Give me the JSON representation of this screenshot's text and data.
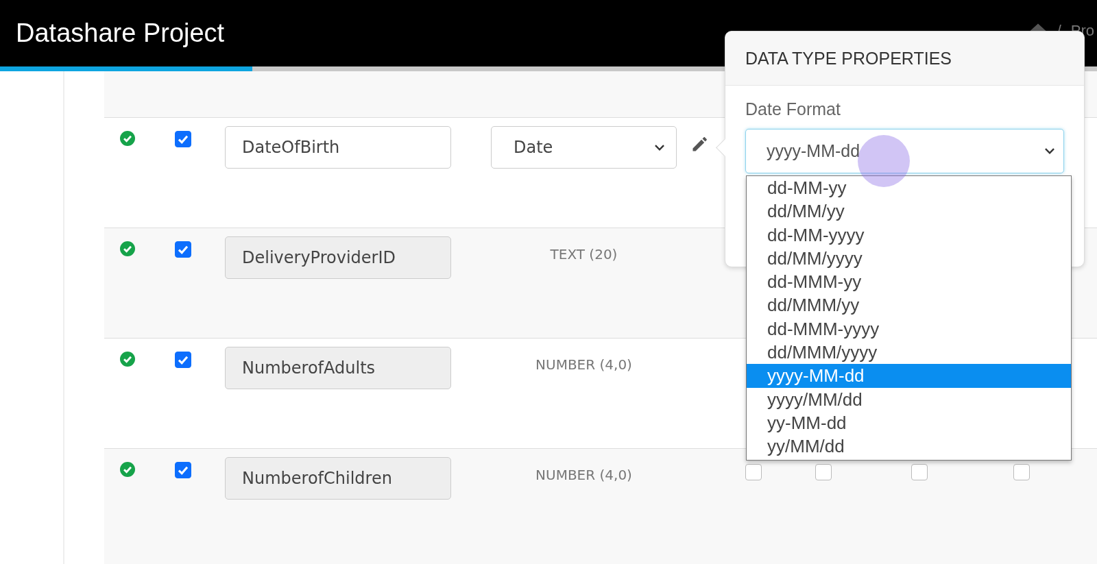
{
  "header": {
    "title": "Datashare Project",
    "progress": {
      "level": 0.23
    },
    "breadcrumb": {
      "separator": "/",
      "item": "Pro"
    }
  },
  "rows": [
    {
      "valid": true,
      "checked": true,
      "name": "DateOfBirth",
      "disabled": false,
      "type": {
        "kind": "select",
        "value": "Date"
      },
      "editable": true
    },
    {
      "valid": true,
      "checked": true,
      "name": "DeliveryProviderID",
      "disabled": true,
      "type": {
        "kind": "text",
        "value": "TEXT (20)"
      },
      "editable": false
    },
    {
      "valid": true,
      "checked": true,
      "name": "NumberofAdults",
      "disabled": true,
      "type": {
        "kind": "text",
        "value": "NUMBER (4,0)"
      },
      "editable": false
    },
    {
      "valid": true,
      "checked": true,
      "name": "NumberofChildren",
      "disabled": true,
      "type": {
        "kind": "text",
        "value": "NUMBER (4,0)"
      },
      "editable": false,
      "flags": [
        {
          "checked": false
        },
        {
          "checked": false
        },
        {
          "checked": false
        },
        {
          "checked": false
        }
      ]
    }
  ],
  "popover": {
    "title": "DATA TYPE PROPERTIES",
    "field_label": "Date Format",
    "value": "yyyy-MM-dd",
    "options": [
      {
        "label": "dd-MM-yy",
        "selected": false
      },
      {
        "label": "dd/MM/yy",
        "selected": false
      },
      {
        "label": "dd-MM-yyyy",
        "selected": false
      },
      {
        "label": "dd/MM/yyyy",
        "selected": false
      },
      {
        "label": "dd-MMM-yy",
        "selected": false
      },
      {
        "label": "dd/MMM/yy",
        "selected": false
      },
      {
        "label": "dd-MMM-yyyy",
        "selected": false
      },
      {
        "label": "dd/MMM/yyyy",
        "selected": false
      },
      {
        "label": "yyyy-MM-dd",
        "selected": true
      },
      {
        "label": "yyyy/MM/dd",
        "selected": false
      },
      {
        "label": "yy-MM-dd",
        "selected": false
      },
      {
        "label": "yy/MM/dd",
        "selected": false
      }
    ]
  }
}
